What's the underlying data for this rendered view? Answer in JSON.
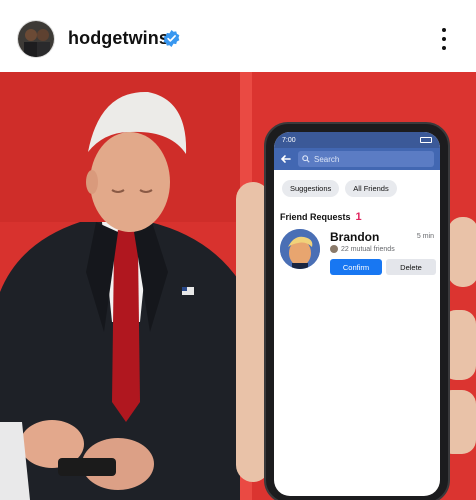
{
  "post": {
    "username": "hodgetwins",
    "verified": true,
    "icons": [
      "avatar",
      "verified-badge-icon",
      "more-options-icon"
    ]
  },
  "image": {
    "background_color": "#d8322e",
    "phone": {
      "status_time": "7:00",
      "search_placeholder": "Search",
      "chips": [
        "Suggestions",
        "All Friends"
      ],
      "requests_title": "Friend Requests",
      "requests_count": "1",
      "request": {
        "name": "Brandon",
        "time": "5 min",
        "mutual": "22 mutual friends",
        "confirm_label": "Confirm",
        "delete_label": "Delete"
      },
      "colors": {
        "header_blue": "#4267b2",
        "confirm_blue": "#1877f2"
      }
    }
  }
}
